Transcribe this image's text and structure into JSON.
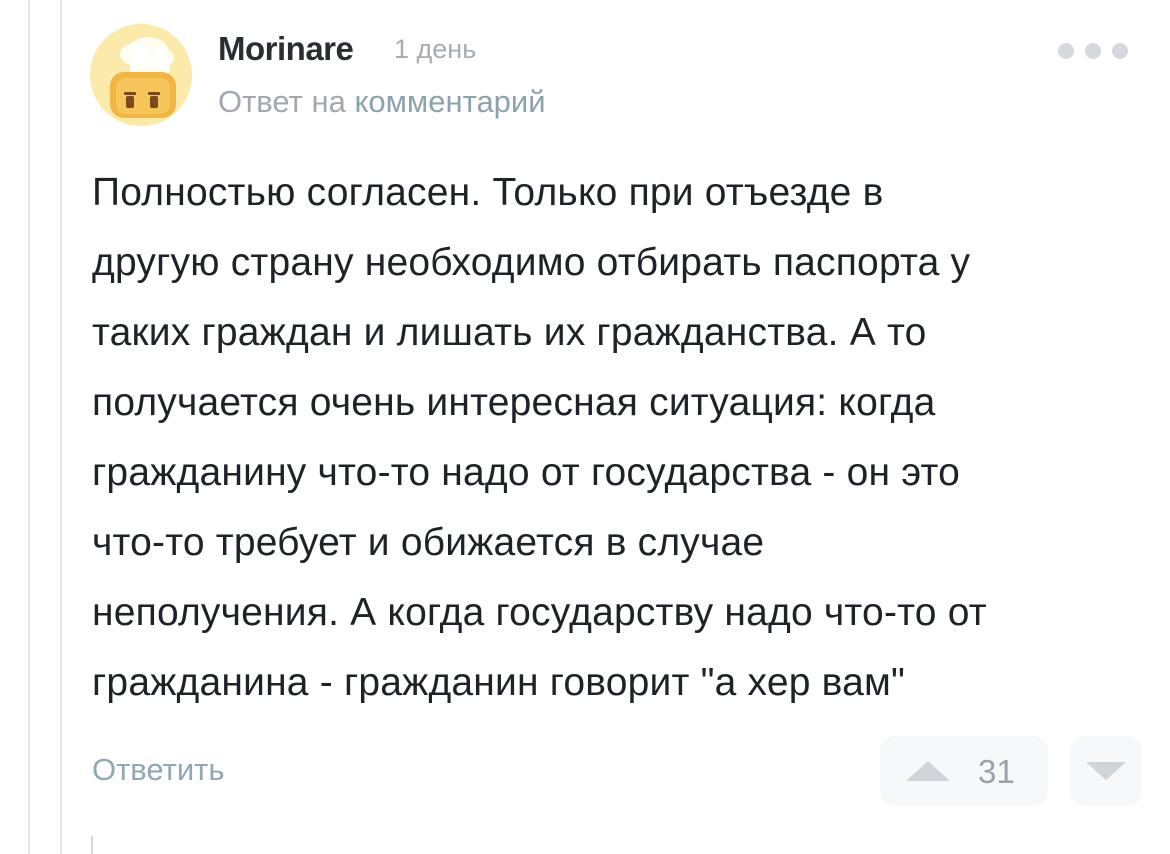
{
  "comment": {
    "author": "Morinare",
    "time": "1 день",
    "reply_prefix": "Ответ на",
    "reply_link": "комментарий",
    "lines": [
      "Полностью согласен. Только при отъезде в",
      "другую страну необходимо отбирать паспорта у",
      "таких граждан и лишать их гражданства. А то",
      "получается очень интересная ситуация: когда",
      "гражданину что-то надо от государства - он это",
      "что-то требует и обижается в случае",
      "неполучения. А когда государству надо что-то от",
      "гражданина - гражданин говорит \"а хер вам\""
    ],
    "reply_label": "Ответить",
    "rating": "31"
  },
  "icons": {
    "avatar": "cartoon-toast-chef-avatar",
    "more": "more-dots-icon",
    "upvote": "triangle-up-icon",
    "downvote": "triangle-down-icon"
  },
  "colors": {
    "text": "#1f2328",
    "muted": "#a2a8af",
    "link": "#8aa3ad",
    "vote_bg": "#f7f8f9",
    "vote_icon": "#d0d5da"
  }
}
